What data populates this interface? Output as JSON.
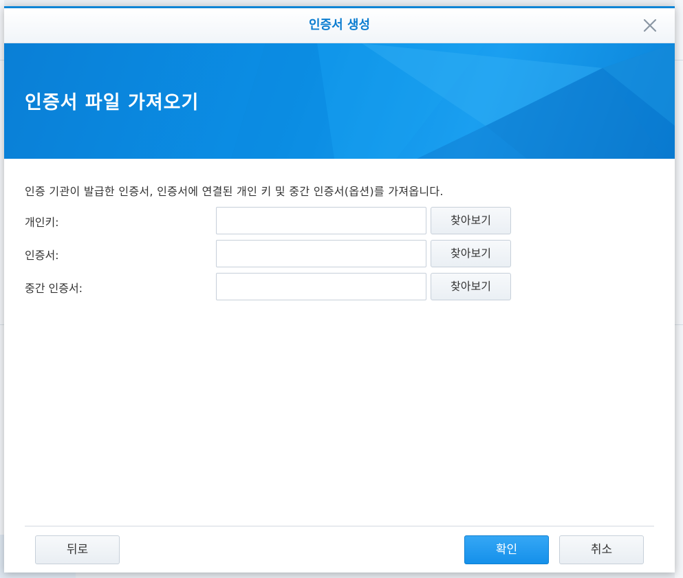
{
  "dialog": {
    "title": "인증서 생성",
    "banner_title": "인증서 파일 가져오기",
    "description": "인증 기관이 발급한 인증서, 인증서에 연결된 개인 키 및 중간 인증서(옵션)를 가져옵니다.",
    "fields": [
      {
        "label": "개인키:",
        "value": "",
        "browse_label": "찾아보기"
      },
      {
        "label": "인증서:",
        "value": "",
        "browse_label": "찾아보기"
      },
      {
        "label": "중간 인증서:",
        "value": "",
        "browse_label": "찾아보기"
      }
    ],
    "buttons": {
      "back": "뒤로",
      "ok": "확인",
      "cancel": "취소"
    }
  },
  "icons": {
    "close": "close-icon"
  },
  "colors": {
    "accent": "#0a84d6",
    "title_text": "#0a7cd0",
    "primary_button": "#1f98ee",
    "banner": "#0b8fe6"
  }
}
